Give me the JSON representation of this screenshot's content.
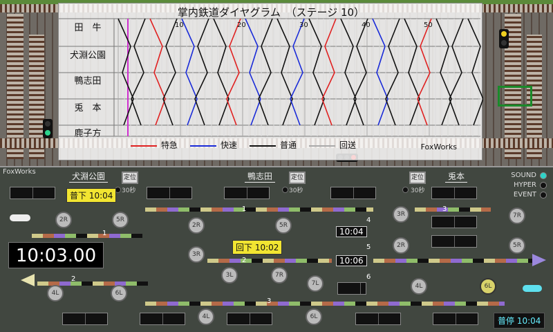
{
  "diagram": {
    "title": "掌内鉄道ダイヤグラム　（ステージ 10）",
    "stations": [
      "田　牛",
      "犬淵公園",
      "鴨志田",
      "兎　本",
      "鹿子方"
    ],
    "ticks": [
      "10",
      "20",
      "30",
      "40",
      "50"
    ],
    "legend": [
      {
        "label": "特急",
        "color": "#e02020"
      },
      {
        "label": "快速",
        "color": "#1a2bd8"
      },
      {
        "label": "普通",
        "color": "#111111"
      },
      {
        "label": "回送",
        "color": "#aaaaaa"
      }
    ],
    "credit": "FoxWorks",
    "colors": {
      "express": "#e02020",
      "rapid": "#1a2bd8",
      "local": "#111111",
      "now_line": "#d030d0"
    }
  },
  "panel": {
    "credit": "FoxWorks",
    "stations": [
      "犬淵公園",
      "鴨志田",
      "兎本"
    ],
    "teii_label": "定位",
    "timer_label": "30秒",
    "clock": "10:03.00",
    "badges": {
      "inubuchi": "普下 10:04",
      "kamoshida": "回下 10:02",
      "uchimoto": "普停 10:04"
    },
    "departures": [
      "10:04",
      "10:06"
    ],
    "track_numbers": [
      "1",
      "1",
      "2",
      "2",
      "3",
      "4",
      "5",
      "6",
      "3",
      "1",
      "2"
    ],
    "signals": [
      "2R",
      "5R",
      "2R",
      "5R",
      "3R",
      "3R",
      "2R",
      "5R",
      "7R",
      "5R",
      "3L",
      "7R",
      "7L",
      "4L",
      "6L",
      "4L",
      "6L",
      "4L",
      "6L",
      "6L"
    ],
    "toggles": [
      {
        "label": "SOUND",
        "on": true
      },
      {
        "label": "HYPER",
        "on": false
      },
      {
        "label": "EVENT",
        "on": false
      }
    ]
  }
}
